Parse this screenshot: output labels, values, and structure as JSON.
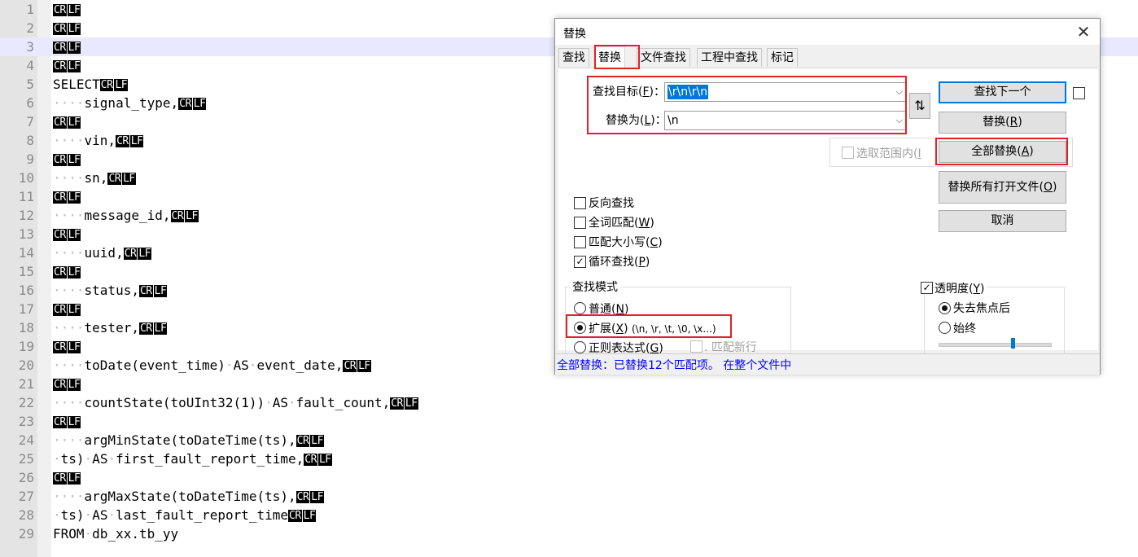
{
  "editor": {
    "eol_cr": "CR",
    "eol_lf": "LF",
    "ws_dot": "·",
    "lines": [
      {
        "num": "1",
        "tokens": []
      },
      {
        "num": "2",
        "tokens": []
      },
      {
        "num": "3",
        "tokens": [],
        "current": true
      },
      {
        "num": "4",
        "tokens": []
      },
      {
        "num": "5",
        "tokens": [
          {
            "t": "SELECT"
          }
        ]
      },
      {
        "num": "6",
        "tokens": [
          {
            "ws": 4
          },
          {
            "t": "signal_type,"
          }
        ]
      },
      {
        "num": "7",
        "tokens": []
      },
      {
        "num": "8",
        "tokens": [
          {
            "ws": 4
          },
          {
            "t": "vin,"
          }
        ]
      },
      {
        "num": "9",
        "tokens": []
      },
      {
        "num": "10",
        "tokens": [
          {
            "ws": 4
          },
          {
            "t": "sn,"
          }
        ]
      },
      {
        "num": "11",
        "tokens": []
      },
      {
        "num": "12",
        "tokens": [
          {
            "ws": 4
          },
          {
            "t": "message_id,"
          }
        ]
      },
      {
        "num": "13",
        "tokens": []
      },
      {
        "num": "14",
        "tokens": [
          {
            "ws": 4
          },
          {
            "t": "uuid,"
          }
        ]
      },
      {
        "num": "15",
        "tokens": []
      },
      {
        "num": "16",
        "tokens": [
          {
            "ws": 4
          },
          {
            "t": "status,"
          }
        ]
      },
      {
        "num": "17",
        "tokens": []
      },
      {
        "num": "18",
        "tokens": [
          {
            "ws": 4
          },
          {
            "t": "tester,"
          }
        ]
      },
      {
        "num": "19",
        "tokens": []
      },
      {
        "num": "20",
        "tokens": [
          {
            "ws": 4
          },
          {
            "t": "toDate(event_time)"
          },
          {
            "ws": 1
          },
          {
            "t": "AS"
          },
          {
            "ws": 1
          },
          {
            "t": "event_date,"
          }
        ]
      },
      {
        "num": "21",
        "tokens": []
      },
      {
        "num": "22",
        "tokens": [
          {
            "ws": 4
          },
          {
            "t": "countState(toUInt32(1))"
          },
          {
            "ws": 1
          },
          {
            "t": "AS"
          },
          {
            "ws": 1
          },
          {
            "t": "fault_count,"
          }
        ]
      },
      {
        "num": "23",
        "tokens": []
      },
      {
        "num": "24",
        "tokens": [
          {
            "ws": 4
          },
          {
            "t": "argMinState(toDateTime(ts),"
          }
        ]
      },
      {
        "num": "25",
        "tokens": [
          {
            "ws": 1
          },
          {
            "t": "ts)"
          },
          {
            "ws": 1
          },
          {
            "t": "AS"
          },
          {
            "ws": 1
          },
          {
            "t": "first_fault_report_time,"
          }
        ]
      },
      {
        "num": "26",
        "tokens": []
      },
      {
        "num": "27",
        "tokens": [
          {
            "ws": 4
          },
          {
            "t": "argMaxState(toDateTime(ts),"
          }
        ]
      },
      {
        "num": "28",
        "tokens": [
          {
            "ws": 1
          },
          {
            "t": "ts)"
          },
          {
            "ws": 1
          },
          {
            "t": "AS"
          },
          {
            "ws": 1
          },
          {
            "t": "last_fault_report_time"
          }
        ]
      },
      {
        "num": "29",
        "tokens": [
          {
            "t": "FROM"
          },
          {
            "ws": 1
          },
          {
            "t": "db_xx.tb_yy"
          }
        ],
        "no_eol": true
      }
    ]
  },
  "dialog": {
    "title": "替换",
    "close_glyph": "✕",
    "tabs": [
      "查找",
      "替换",
      "文件查找",
      "工程中查找",
      "标记"
    ],
    "active_tab": 1,
    "find_label": "查找目标",
    "find_key": "F",
    "find_value": "\\r\\n\\r\\n",
    "replace_label": "替换为",
    "replace_key": "L",
    "replace_value": "\\n",
    "swap_glyph": "⇅",
    "dropdown_glyph": "⌵",
    "buttons": {
      "find_next": "查找下一个",
      "replace": "替换",
      "replace_key": "R",
      "replace_all": "全部替换",
      "replace_all_key": "A",
      "replace_all_open": "替换所有打开文件",
      "replace_all_open_key": "O",
      "cancel": "取消"
    },
    "in_selection": "选取范围内",
    "in_selection_key": "I",
    "options": [
      {
        "label": "反向查找",
        "key": "",
        "checked": false
      },
      {
        "label": "全词匹配",
        "key": "W",
        "checked": false
      },
      {
        "label": "匹配大小写",
        "key": "C",
        "checked": false
      },
      {
        "label": "循环查找",
        "key": "P",
        "checked": true
      }
    ],
    "search_mode": {
      "title": "查找模式",
      "normal": "普通",
      "normal_key": "N",
      "extended": "扩展",
      "extended_key": "X",
      "extended_hint": "(\\n, \\r, \\t, \\0, \\x...)",
      "regex": "正则表达式",
      "regex_key": "G",
      "dot_newline": ". 匹配新行",
      "selected": "extended"
    },
    "transparency": {
      "title": "透明度",
      "title_key": "Y",
      "checked": true,
      "on_lose_focus": "失去焦点后",
      "always": "始终",
      "selected": "on_lose_focus",
      "level": 0.65
    },
    "status": "全部替换：已替换12个匹配项。 在整个文件中",
    "check_glyph": "✓"
  }
}
